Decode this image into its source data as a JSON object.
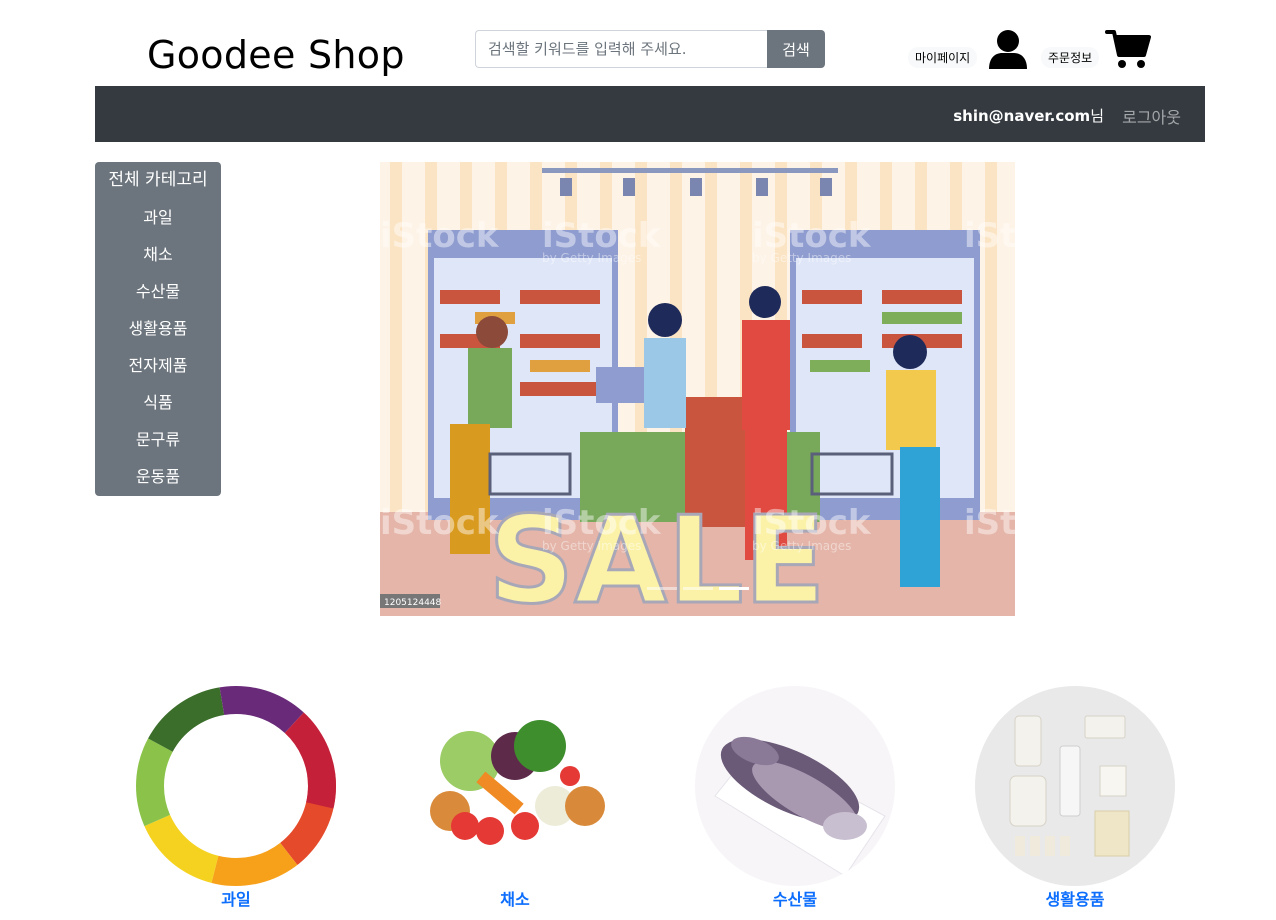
{
  "header": {
    "logo": "Goodee Shop",
    "search_placeholder": "검색할 키워드를 입력해 주세요.",
    "search_button": "검색",
    "mypage_label": "마이페이지",
    "orders_label": "주문정보"
  },
  "navbar": {
    "user_email": "shin@naver.com",
    "user_suffix": "님",
    "logout_label": "로그아웃"
  },
  "sidebar": {
    "items": [
      {
        "label": "전체 카테고리"
      },
      {
        "label": "과일"
      },
      {
        "label": "채소"
      },
      {
        "label": "수산물"
      },
      {
        "label": "생활용품"
      },
      {
        "label": "전자제품"
      },
      {
        "label": "식품"
      },
      {
        "label": "문구류"
      },
      {
        "label": "운동품"
      }
    ]
  },
  "banner": {
    "headline": "SALE",
    "watermark": "iStock",
    "watermark_sub": "by Getty Images",
    "image_id": "1205124448",
    "slides": 3,
    "active_slide": 3
  },
  "categories": [
    {
      "label": "과일"
    },
    {
      "label": "채소"
    },
    {
      "label": "수산물"
    },
    {
      "label": "생활용품"
    }
  ],
  "colors": {
    "navbar": "#343a40",
    "sidebar": "#6c757d",
    "link": "#0d6efd"
  }
}
